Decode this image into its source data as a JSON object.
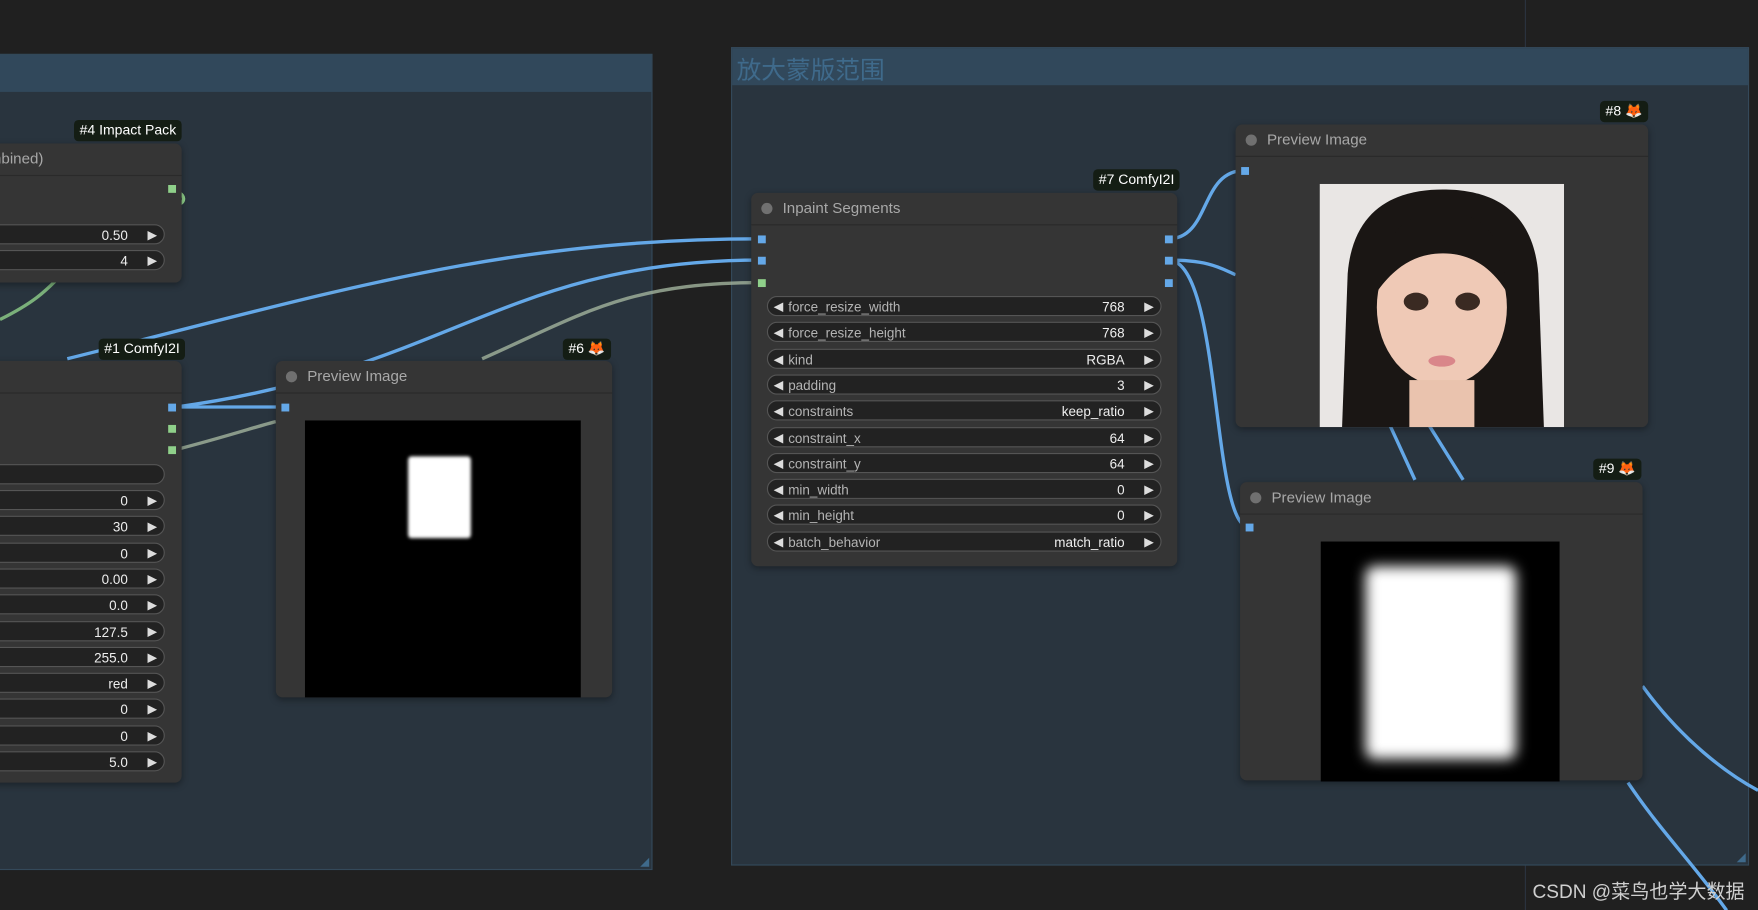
{
  "groups": [
    {
      "title": ""
    },
    {
      "title": "放大蒙版范围"
    }
  ],
  "nodes": {
    "n4": {
      "badge": "#4 Impact Pack",
      "title": "mbined)",
      "widgets": [
        {
          "value": "0.50"
        },
        {
          "value": "4"
        }
      ]
    },
    "n1": {
      "badge": "#1 ComfyI2I",
      "text_field": "",
      "widgets": [
        {
          "value": "0"
        },
        {
          "value": "30"
        },
        {
          "value": "0"
        },
        {
          "value": "0.00"
        },
        {
          "value": "0.0"
        },
        {
          "value": "127.5"
        },
        {
          "value": "255.0"
        },
        {
          "value": "red"
        },
        {
          "value": "0"
        },
        {
          "value": "0"
        },
        {
          "value": "5.0"
        }
      ]
    },
    "n6": {
      "badge": "#6 🦊",
      "title": "Preview Image"
    },
    "n7": {
      "badge": "#7 ComfyI2I",
      "title": "Inpaint Segments",
      "widgets": [
        {
          "label": "force_resize_width",
          "value": "768"
        },
        {
          "label": "force_resize_height",
          "value": "768"
        },
        {
          "label": "kind",
          "value": "RGBA"
        },
        {
          "label": "padding",
          "value": "3"
        },
        {
          "label": "constraints",
          "value": "keep_ratio"
        },
        {
          "label": "constraint_x",
          "value": "64"
        },
        {
          "label": "constraint_y",
          "value": "64"
        },
        {
          "label": "min_width",
          "value": "0"
        },
        {
          "label": "min_height",
          "value": "0"
        },
        {
          "label": "batch_behavior",
          "value": "match_ratio"
        }
      ]
    },
    "n8": {
      "badge": "#8 🦊",
      "title": "Preview Image"
    },
    "n9": {
      "badge": "#9 🦊",
      "title": "Preview Image"
    }
  },
  "arrows": {
    "left": "◀",
    "right": "▶"
  },
  "colors": {
    "image_wire": "#64a8e8",
    "mask_wire": "#8fd08a",
    "group": "#29343e"
  },
  "watermark": "CSDN @菜鸟也学大数据"
}
